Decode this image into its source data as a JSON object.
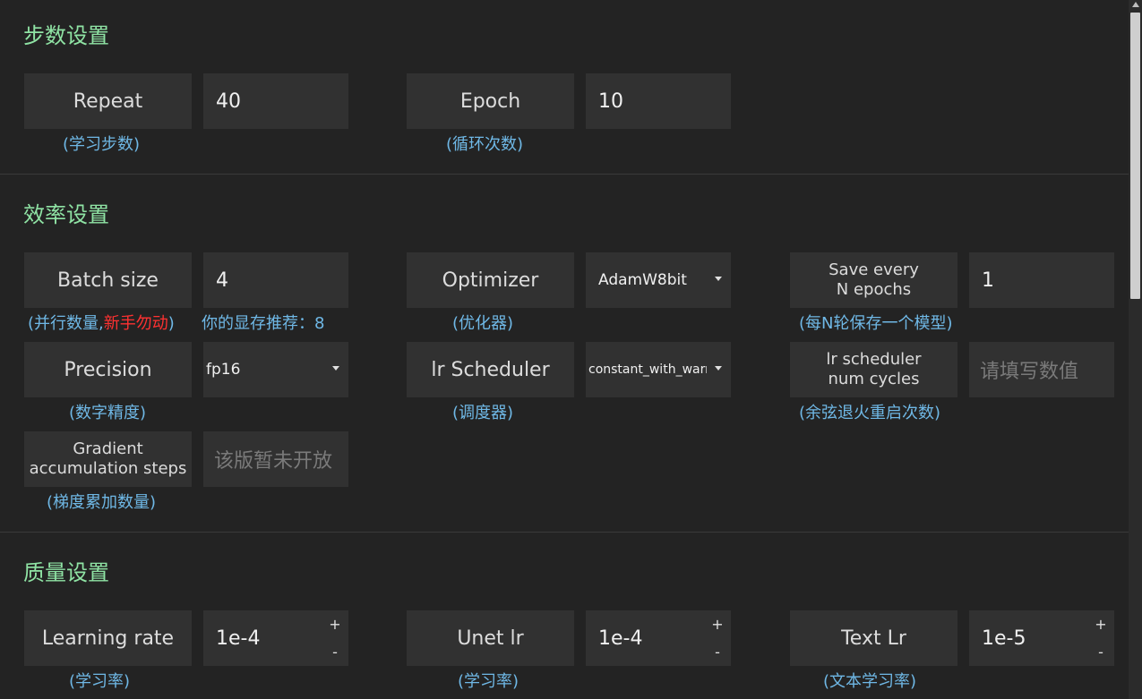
{
  "sections": {
    "steps": {
      "title": "步数设置",
      "repeat": {
        "label": "Repeat",
        "value": "40",
        "hint": "(学习步数)"
      },
      "epoch": {
        "label": "Epoch",
        "value": "10",
        "hint": "(循环次数)"
      }
    },
    "efficiency": {
      "title": "效率设置",
      "batch_size": {
        "label": "Batch size",
        "value": "4",
        "hint_pre": "(并行数量,",
        "hint_red": "新手勿动",
        "hint_post": ")",
        "vram_hint": "你的显存推荐：8"
      },
      "optimizer": {
        "label": "Optimizer",
        "selected": "AdamW8bit",
        "hint": "(优化器)"
      },
      "save_every": {
        "label_line1": "Save every",
        "label_line2": "N epochs",
        "value": "1",
        "hint": "(每N轮保存一个模型)"
      },
      "precision": {
        "label": "Precision",
        "selected": "fp16",
        "hint": "(数字精度)"
      },
      "lr_scheduler": {
        "label": "lr Scheduler",
        "selected": "constant_with_warmup",
        "hint": "(调度器)"
      },
      "lr_cycles": {
        "label_line1": "lr scheduler",
        "label_line2": "num cycles",
        "placeholder": "请填写数值",
        "hint": "(余弦退火重启次数)"
      },
      "grad_accum": {
        "label_line1": "Gradient",
        "label_line2": "accumulation steps",
        "placeholder": "该版暂未开放",
        "hint": "(梯度累加数量)"
      }
    },
    "quality": {
      "title": "质量设置",
      "learning_rate": {
        "label": "Learning rate",
        "value": "1e-4",
        "hint": "(学习率)"
      },
      "unet_lr": {
        "label": "Unet lr",
        "value": "1e-4",
        "hint": "(学习率)"
      },
      "text_lr": {
        "label": "Text Lr",
        "value": "1e-5",
        "hint": "(文本学习率)"
      }
    }
  },
  "stepper": {
    "plus": "+",
    "minus": "-"
  },
  "icons": {
    "caret": "caret-down-icon"
  },
  "colors": {
    "bg": "#232323",
    "field": "#313131",
    "section_title": "#8fe3a4",
    "hint": "#6fb8e6",
    "warning": "#ff3131"
  }
}
